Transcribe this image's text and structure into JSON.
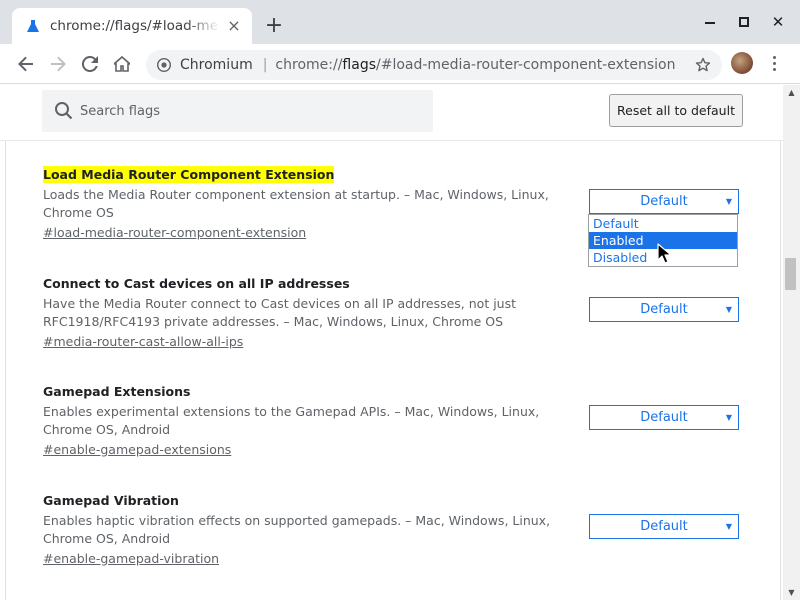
{
  "colors": {
    "accent": "#1a73e8",
    "highlight": "#ffff00",
    "tabstrip": "#dee1e6"
  },
  "tab": {
    "title": "chrome://flags/#load-media-router-component-extension",
    "icon": "flask-icon"
  },
  "toolbar": {
    "site_chip": "Chromium",
    "url_scheme": "chrome://",
    "url_host": "flags",
    "url_rest": "/#load-media-router-component-extension"
  },
  "search": {
    "placeholder": "Search flags"
  },
  "reset_label": "Reset all to default",
  "flags": [
    {
      "name": "Load Media Router Component Extension",
      "description": "Loads the Media Router component extension at startup. – Mac, Windows, Linux, Chrome OS",
      "link": "#load-media-router-component-extension",
      "value": "Default"
    },
    {
      "name": "Connect to Cast devices on all IP addresses",
      "description": "Have the Media Router connect to Cast devices on all IP addresses, not just RFC1918/RFC4193 private addresses. – Mac, Windows, Linux, Chrome OS",
      "link": "#media-router-cast-allow-all-ips",
      "value": "Default"
    },
    {
      "name": "Gamepad Extensions",
      "description": "Enables experimental extensions to the Gamepad APIs. – Mac, Windows, Linux, Chrome OS, Android",
      "link": "#enable-gamepad-extensions",
      "value": "Default"
    },
    {
      "name": "Gamepad Vibration",
      "description": "Enables haptic vibration effects on supported gamepads. – Mac, Windows, Linux, Chrome OS, Android",
      "link": "#enable-gamepad-vibration",
      "value": "Default"
    }
  ],
  "dropdown": {
    "options": [
      "Default",
      "Enabled",
      "Disabled"
    ],
    "highlighted": "Enabled"
  }
}
